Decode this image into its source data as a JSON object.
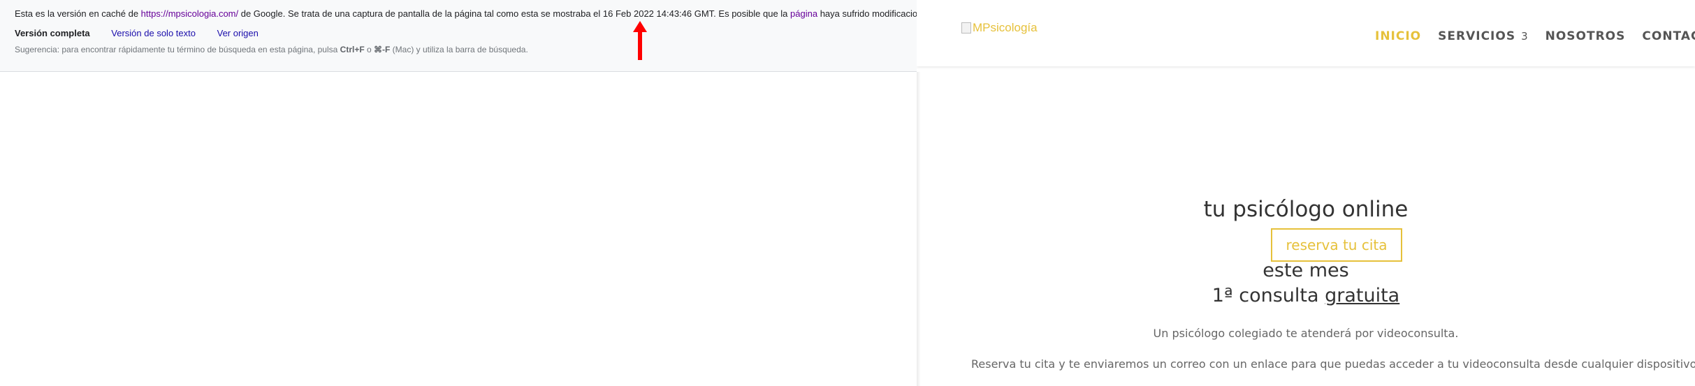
{
  "cache_banner": {
    "line_prefix": "Esta es la versión en caché de ",
    "cached_url": "https://mpsicologia.com/",
    "line_middle": " de Google. Se trata de una captura de pantalla de la página tal como esta se mostraba el 16 Feb 2022 14:43:46 GMT. Es posible que la ",
    "page_link": "página",
    "line_suffix": " haya sufrido modificacio",
    "full_version": "Versión completa",
    "text_only": "Versión de solo texto",
    "view_source": "Ver origen",
    "tip_prefix": "Sugerencia: para encontrar rápidamente tu término de búsqueda en esta página, pulsa ",
    "tip_shortcut1": "Ctrl+F",
    "tip_or": " o ",
    "tip_shortcut2": "⌘-F",
    "tip_suffix": " (Mac) y utiliza la barra de búsqueda."
  },
  "annotation": {
    "arrow_color": "#ff0000"
  },
  "site": {
    "logo_alt": "MPsicología",
    "nav": {
      "inicio": "INICIO",
      "servicios": "SERVICIOS",
      "servicios_caret": "3",
      "nosotros": "NOSOTROS",
      "contacto": "CONTACT"
    },
    "hero": {
      "title": "tu psicólogo online",
      "cta": "reserva tu cita",
      "line1": "este mes",
      "line2_prefix": "1ª consulta ",
      "line2_underlined": "gratuita",
      "desc1": "Un psicólogo colegiado te atenderá por videoconsulta.",
      "desc2": "Reserva tu cita y te enviaremos un correo con un enlace para que puedas acceder a tu videoconsulta desde cualquier dispositivo"
    },
    "colors": {
      "accent": "#e6c13b",
      "text": "#333333",
      "nav_text": "#555555"
    }
  }
}
